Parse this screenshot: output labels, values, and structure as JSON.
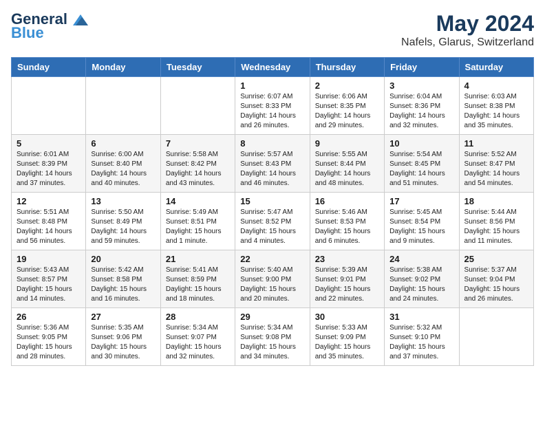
{
  "header": {
    "logo_line1": "General",
    "logo_line2": "Blue",
    "main_title": "May 2024",
    "subtitle": "Nafels, Glarus, Switzerland"
  },
  "days_of_week": [
    "Sunday",
    "Monday",
    "Tuesday",
    "Wednesday",
    "Thursday",
    "Friday",
    "Saturday"
  ],
  "weeks": [
    [
      {
        "day": "",
        "info": ""
      },
      {
        "day": "",
        "info": ""
      },
      {
        "day": "",
        "info": ""
      },
      {
        "day": "1",
        "info": "Sunrise: 6:07 AM\nSunset: 8:33 PM\nDaylight: 14 hours\nand 26 minutes."
      },
      {
        "day": "2",
        "info": "Sunrise: 6:06 AM\nSunset: 8:35 PM\nDaylight: 14 hours\nand 29 minutes."
      },
      {
        "day": "3",
        "info": "Sunrise: 6:04 AM\nSunset: 8:36 PM\nDaylight: 14 hours\nand 32 minutes."
      },
      {
        "day": "4",
        "info": "Sunrise: 6:03 AM\nSunset: 8:38 PM\nDaylight: 14 hours\nand 35 minutes."
      }
    ],
    [
      {
        "day": "5",
        "info": "Sunrise: 6:01 AM\nSunset: 8:39 PM\nDaylight: 14 hours\nand 37 minutes."
      },
      {
        "day": "6",
        "info": "Sunrise: 6:00 AM\nSunset: 8:40 PM\nDaylight: 14 hours\nand 40 minutes."
      },
      {
        "day": "7",
        "info": "Sunrise: 5:58 AM\nSunset: 8:42 PM\nDaylight: 14 hours\nand 43 minutes."
      },
      {
        "day": "8",
        "info": "Sunrise: 5:57 AM\nSunset: 8:43 PM\nDaylight: 14 hours\nand 46 minutes."
      },
      {
        "day": "9",
        "info": "Sunrise: 5:55 AM\nSunset: 8:44 PM\nDaylight: 14 hours\nand 48 minutes."
      },
      {
        "day": "10",
        "info": "Sunrise: 5:54 AM\nSunset: 8:45 PM\nDaylight: 14 hours\nand 51 minutes."
      },
      {
        "day": "11",
        "info": "Sunrise: 5:52 AM\nSunset: 8:47 PM\nDaylight: 14 hours\nand 54 minutes."
      }
    ],
    [
      {
        "day": "12",
        "info": "Sunrise: 5:51 AM\nSunset: 8:48 PM\nDaylight: 14 hours\nand 56 minutes."
      },
      {
        "day": "13",
        "info": "Sunrise: 5:50 AM\nSunset: 8:49 PM\nDaylight: 14 hours\nand 59 minutes."
      },
      {
        "day": "14",
        "info": "Sunrise: 5:49 AM\nSunset: 8:51 PM\nDaylight: 15 hours\nand 1 minute."
      },
      {
        "day": "15",
        "info": "Sunrise: 5:47 AM\nSunset: 8:52 PM\nDaylight: 15 hours\nand 4 minutes."
      },
      {
        "day": "16",
        "info": "Sunrise: 5:46 AM\nSunset: 8:53 PM\nDaylight: 15 hours\nand 6 minutes."
      },
      {
        "day": "17",
        "info": "Sunrise: 5:45 AM\nSunset: 8:54 PM\nDaylight: 15 hours\nand 9 minutes."
      },
      {
        "day": "18",
        "info": "Sunrise: 5:44 AM\nSunset: 8:56 PM\nDaylight: 15 hours\nand 11 minutes."
      }
    ],
    [
      {
        "day": "19",
        "info": "Sunrise: 5:43 AM\nSunset: 8:57 PM\nDaylight: 15 hours\nand 14 minutes."
      },
      {
        "day": "20",
        "info": "Sunrise: 5:42 AM\nSunset: 8:58 PM\nDaylight: 15 hours\nand 16 minutes."
      },
      {
        "day": "21",
        "info": "Sunrise: 5:41 AM\nSunset: 8:59 PM\nDaylight: 15 hours\nand 18 minutes."
      },
      {
        "day": "22",
        "info": "Sunrise: 5:40 AM\nSunset: 9:00 PM\nDaylight: 15 hours\nand 20 minutes."
      },
      {
        "day": "23",
        "info": "Sunrise: 5:39 AM\nSunset: 9:01 PM\nDaylight: 15 hours\nand 22 minutes."
      },
      {
        "day": "24",
        "info": "Sunrise: 5:38 AM\nSunset: 9:02 PM\nDaylight: 15 hours\nand 24 minutes."
      },
      {
        "day": "25",
        "info": "Sunrise: 5:37 AM\nSunset: 9:04 PM\nDaylight: 15 hours\nand 26 minutes."
      }
    ],
    [
      {
        "day": "26",
        "info": "Sunrise: 5:36 AM\nSunset: 9:05 PM\nDaylight: 15 hours\nand 28 minutes."
      },
      {
        "day": "27",
        "info": "Sunrise: 5:35 AM\nSunset: 9:06 PM\nDaylight: 15 hours\nand 30 minutes."
      },
      {
        "day": "28",
        "info": "Sunrise: 5:34 AM\nSunset: 9:07 PM\nDaylight: 15 hours\nand 32 minutes."
      },
      {
        "day": "29",
        "info": "Sunrise: 5:34 AM\nSunset: 9:08 PM\nDaylight: 15 hours\nand 34 minutes."
      },
      {
        "day": "30",
        "info": "Sunrise: 5:33 AM\nSunset: 9:09 PM\nDaylight: 15 hours\nand 35 minutes."
      },
      {
        "day": "31",
        "info": "Sunrise: 5:32 AM\nSunset: 9:10 PM\nDaylight: 15 hours\nand 37 minutes."
      },
      {
        "day": "",
        "info": ""
      }
    ]
  ]
}
